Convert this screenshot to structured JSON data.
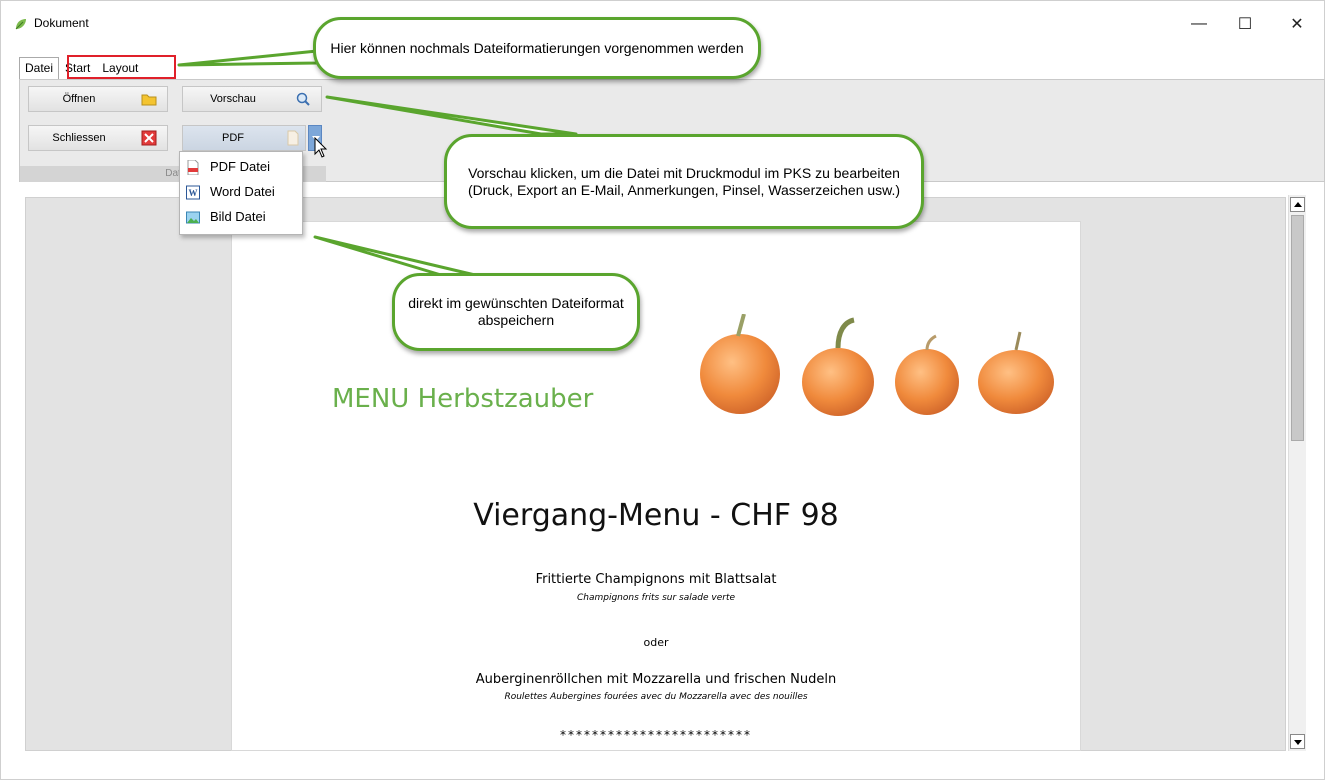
{
  "window": {
    "title": "Dokument",
    "controls": {
      "minimize": "—",
      "maximize": "☐",
      "close": "✕"
    }
  },
  "ribbon": {
    "tabs": [
      {
        "label": "Datei"
      },
      {
        "label": "Start"
      },
      {
        "label": "Layout"
      }
    ],
    "buttons": {
      "open": "Öffnen",
      "preview": "Vorschau",
      "close": "Schliessen",
      "pdf": "PDF"
    },
    "group_label": "Dat"
  },
  "dropdown": {
    "items": [
      {
        "label": "PDF Datei",
        "icon": "pdf-file-icon"
      },
      {
        "label": "Word Datei",
        "icon": "word-file-icon"
      },
      {
        "label": "Bild Datei",
        "icon": "image-file-icon"
      }
    ]
  },
  "callouts": {
    "tabs_note": "Hier können nochmals Dateiformatierungen vorgenommen werden",
    "preview_note": "Vorschau klicken, um die Datei mit Druckmodul im PKS zu bearbeiten (Druck, Export an E-Mail, Anmerkungen, Pinsel, Wasserzeichen usw.)",
    "save_note": "direkt im gewünschten Dateiformat abspeichern"
  },
  "document": {
    "menu_title": "MENU Herbstzauber",
    "course_heading": "Viergang-Menu - CHF 98",
    "dish1": "Frittierte Champignons mit Blattsalat",
    "dish1_fr": "Champignons frits sur salade verte",
    "or": "oder",
    "dish2": "Auberginenröllchen mit Mozzarella und frischen Nudeln",
    "dish2_fr": "Roulettes Aubergines fourées avec du Mozzarella avec des nouilles",
    "separator": "************************"
  },
  "colors": {
    "callout_border": "#5aa52e",
    "menu_title": "#6ab04c",
    "highlight_box": "#e0202a",
    "pumpkin": "#f08a3c"
  }
}
